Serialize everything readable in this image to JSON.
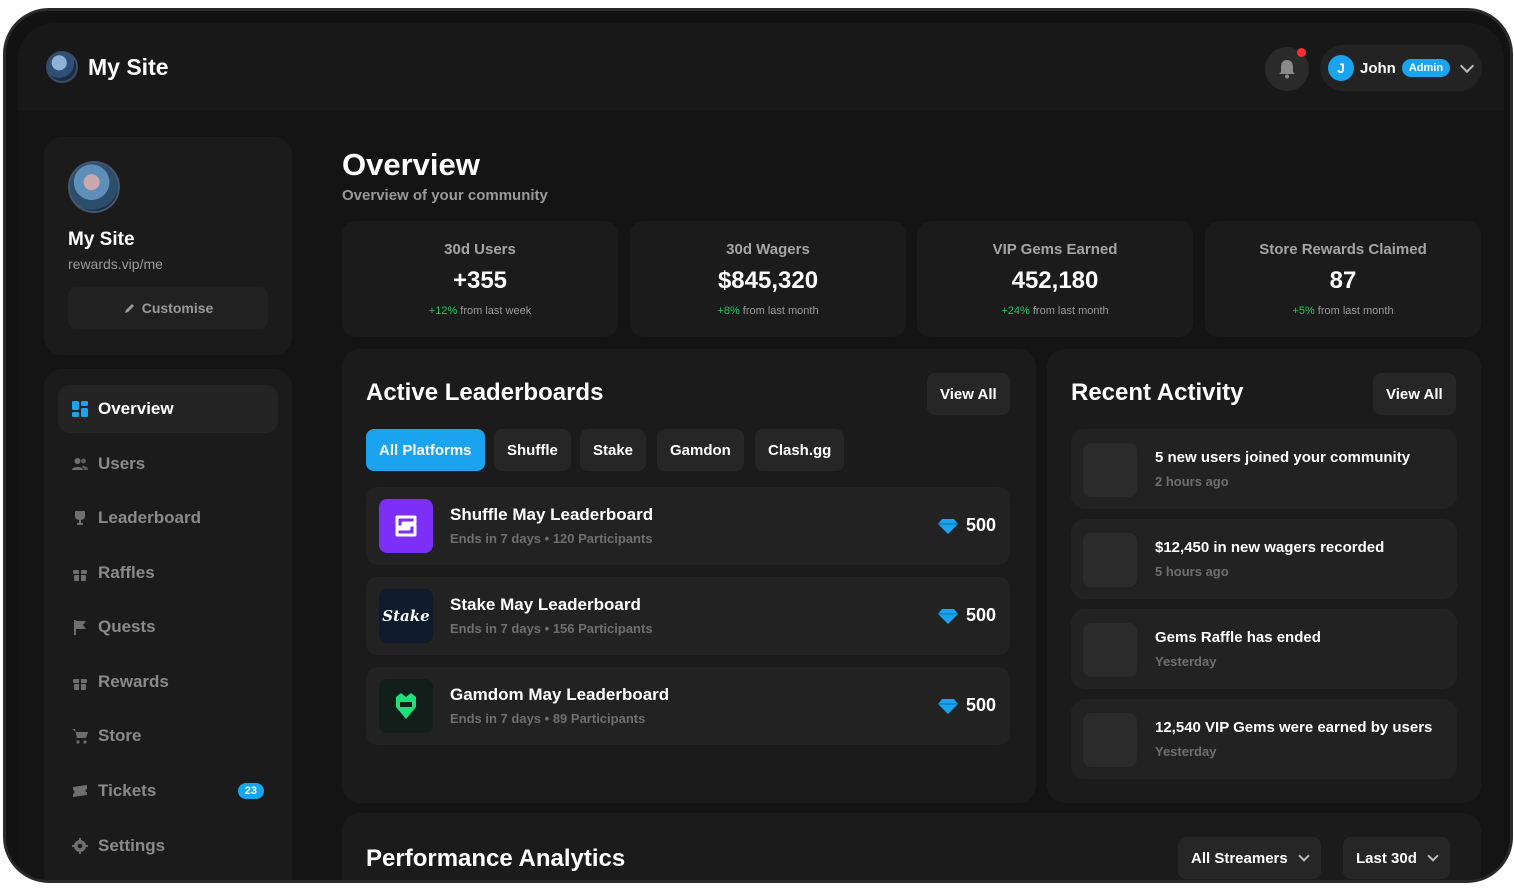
{
  "header": {
    "site_name": "My Site",
    "notifications_icon": "bell-icon",
    "user": {
      "initial": "J",
      "name": "John",
      "role": "Admin"
    }
  },
  "profile": {
    "name": "My Site",
    "url": "rewards.vip/me",
    "customise_label": "Customise"
  },
  "sidebar": {
    "items": [
      {
        "label": "Overview",
        "icon": "grid-icon",
        "active": true
      },
      {
        "label": "Users",
        "icon": "users-icon"
      },
      {
        "label": "Leaderboard",
        "icon": "trophy-icon"
      },
      {
        "label": "Raffles",
        "icon": "gift-icon"
      },
      {
        "label": "Quests",
        "icon": "flag-icon"
      },
      {
        "label": "Rewards",
        "icon": "gift-icon"
      },
      {
        "label": "Store",
        "icon": "cart-icon"
      },
      {
        "label": "Tickets",
        "icon": "ticket-icon",
        "badge": "23"
      },
      {
        "label": "Settings",
        "icon": "gear-icon"
      }
    ]
  },
  "page": {
    "title": "Overview",
    "subtitle": "Overview of your community"
  },
  "stats": [
    {
      "label": "30d Users",
      "value": "+355",
      "delta": "+12%",
      "delta_suffix": " from last week"
    },
    {
      "label": "30d Wagers",
      "value": "$845,320",
      "delta": "+8%",
      "delta_suffix": " from last month"
    },
    {
      "label": "VIP Gems Earned",
      "value": "452,180",
      "delta": "+24%",
      "delta_suffix": " from last month"
    },
    {
      "label": "Store Rewards Claimed",
      "value": "87",
      "delta": "+5%",
      "delta_suffix": " from last month"
    }
  ],
  "leaderboards": {
    "title": "Active Leaderboards",
    "view_all": "View All",
    "tabs": [
      "All Platforms",
      "Shuffle",
      "Stake",
      "Gamdon",
      "Clash.gg"
    ],
    "rows": [
      {
        "title": "Shuffle May Leaderboard",
        "meta_ends": "Ends in 7 days",
        "meta_participants": "120 Participants",
        "prize": "500",
        "logo": "shuffle-logo"
      },
      {
        "title": "Stake May Leaderboard",
        "meta_ends": "Ends in 7 days",
        "meta_participants": "156 Participants",
        "prize": "500",
        "logo": "stake-logo",
        "logo_text": "Stake"
      },
      {
        "title": "Gamdom May Leaderboard",
        "meta_ends": "Ends in 7 days",
        "meta_participants": "89 Participants",
        "prize": "500",
        "logo": "gamdom-logo"
      }
    ]
  },
  "activity": {
    "title": "Recent Activity",
    "view_all": "View All",
    "items": [
      {
        "title": "5 new users joined your community",
        "time": "2 hours ago"
      },
      {
        "title": "$12,450 in new wagers recorded",
        "time": "5 hours ago"
      },
      {
        "title": "Gems Raffle has ended",
        "time": "Yesterday"
      },
      {
        "title": "12,540 VIP Gems were earned by users",
        "time": "Yesterday"
      }
    ]
  },
  "analytics": {
    "title": "Performance Analytics",
    "streamers_filter": "All Streamers",
    "period_filter": "Last 30d"
  },
  "colors": {
    "accent": "#1aa3ee",
    "positive": "#22c55e",
    "notification_dot": "#ff2d2d",
    "shuffle": "#7b2ff7",
    "gamdom": "#1de07a"
  }
}
